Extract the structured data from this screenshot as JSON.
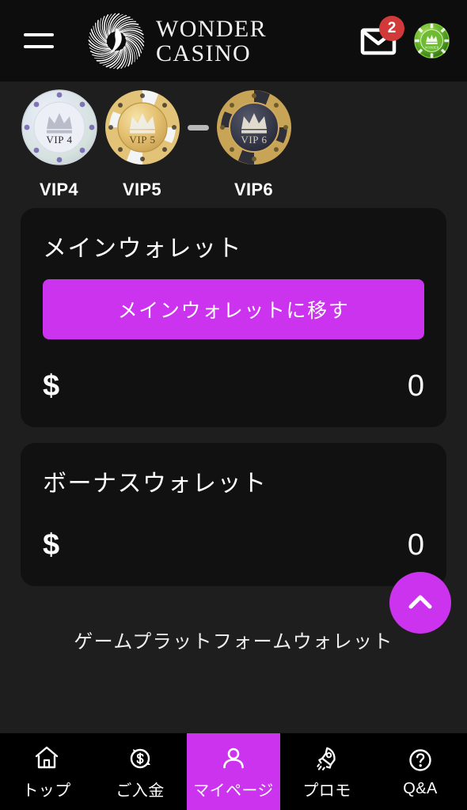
{
  "header": {
    "menu_icon": "hamburger-menu-icon",
    "brand_line1": "WONDER",
    "brand_line2": "CASINO",
    "logo_icon": "wonder-casino-spiral-logo",
    "mail_icon": "mail-envelope-icon",
    "mail_badge_count": "2",
    "avatar_icon": "vip-chip-avatar-green",
    "background_color": "#0d0d0d"
  },
  "vip": {
    "separator_icon": "dash-separator",
    "tiers": [
      {
        "label": "VIP4",
        "chip_text": "VIP 4",
        "style": "holographic-silver"
      },
      {
        "label": "VIP5",
        "chip_text": "VIP 5",
        "style": "gold-white"
      },
      {
        "label": "VIP6",
        "chip_text": "VIP 6",
        "style": "dark-gold"
      }
    ]
  },
  "main_wallet": {
    "title": "メインウォレット",
    "transfer_button": "メインウォレットに移す",
    "currency": "$",
    "balance": "0"
  },
  "bonus_wallet": {
    "title": "ボーナスウォレット",
    "currency": "$",
    "balance": "0"
  },
  "platform_wallet": {
    "label": "ゲームプラットフォームウォレット"
  },
  "fab": {
    "icon": "chevron-up-icon",
    "color": "#cc33ee"
  },
  "bottom_nav": {
    "active_color": "#cc33ee",
    "items": [
      {
        "label": "トップ",
        "icon": "home-icon",
        "active": false
      },
      {
        "label": "ご入金",
        "icon": "coin-dollar-icon",
        "active": false
      },
      {
        "label": "マイページ",
        "icon": "user-person-icon",
        "active": true
      },
      {
        "label": "プロモ",
        "icon": "rocket-icon",
        "active": false
      },
      {
        "label": "Q&A",
        "icon": "question-circle-icon",
        "active": false
      }
    ]
  },
  "theme": {
    "page_background": "#1e1e1e",
    "card_background": "#111111",
    "accent": "#cc33ee",
    "badge_red": "#d23a3a"
  }
}
